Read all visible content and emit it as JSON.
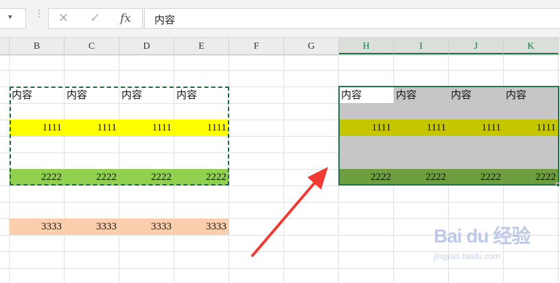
{
  "formula_bar": {
    "name_box_dropdown": "▾",
    "cancel": "✕",
    "enter": "✓",
    "function": "fx",
    "content": "内容"
  },
  "columns": [
    "B",
    "C",
    "D",
    "E",
    "F",
    "G",
    "H",
    "I",
    "J",
    "K"
  ],
  "selected_columns": [
    "H",
    "I",
    "J",
    "K"
  ],
  "source_range": {
    "header": [
      "内容",
      "内容",
      "内容",
      "内容"
    ],
    "row_1111": [
      "1111",
      "1111",
      "1111",
      "1111"
    ],
    "row_2222": [
      "2222",
      "2222",
      "2222",
      "2222"
    ],
    "row_3333": [
      "3333",
      "3333",
      "3333",
      "3333"
    ]
  },
  "pasted_range": {
    "header": [
      "内容",
      "内容",
      "内容",
      "内容"
    ],
    "row_1111": [
      "1111",
      "1111",
      "1111",
      "1111"
    ],
    "row_2222": [
      "2222",
      "2222",
      "2222",
      "2222"
    ]
  },
  "colors": {
    "yellow": "#ffff00",
    "green": "#92d050",
    "peach": "#fbcfae",
    "selected_gray": "#c6c6c6",
    "selected_yellow": "#c6c600",
    "selected_green": "#6e9e3d",
    "excel_green": "#217346",
    "arrow_red": "#f03a32"
  },
  "watermark": {
    "brand": "Bai du 经验",
    "url": "jingyan.baidu.com"
  }
}
